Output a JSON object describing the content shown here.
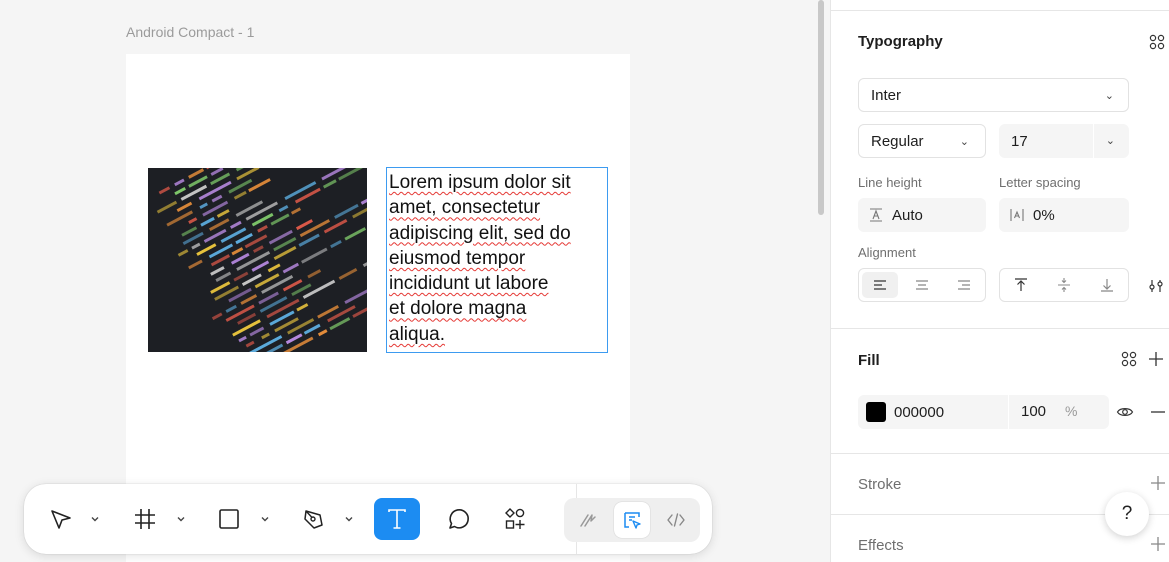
{
  "canvas": {
    "frame_label": "Android Compact - 1",
    "text_lines": [
      "Lorem ipsum dolor sit",
      "amet, consectetur",
      "adipiscing elit, sed do",
      "eiusmod tempor",
      "incididunt ut  labore",
      "et dolore magna",
      "aliqua."
    ]
  },
  "toolbar": {
    "tools": [
      "move-tool",
      "frame-tool",
      "shape-tool",
      "pen-tool",
      "text-tool",
      "comment-tool",
      "actions-tool"
    ],
    "active_tool": "text-tool",
    "dev_tools": [
      "draw-mode",
      "design-mode",
      "dev-mode"
    ],
    "dev_selected": "design-mode"
  },
  "panel": {
    "typography": {
      "title": "Typography",
      "font_family": "Inter",
      "font_style": "Regular",
      "font_size": "17",
      "line_height_label": "Line height",
      "line_height_value": "Auto",
      "letter_spacing_label": "Letter spacing",
      "letter_spacing_value": "0%",
      "alignment_label": "Alignment"
    },
    "fill": {
      "title": "Fill",
      "hex": "000000",
      "opacity": "100",
      "opacity_unit": "%",
      "swatch_color": "#000000"
    },
    "stroke": {
      "title": "Stroke"
    },
    "effects": {
      "title": "Effects"
    },
    "help_label": "?"
  },
  "colors": {
    "accent": "#1c8cf2",
    "selection": "#3d9bf0"
  }
}
